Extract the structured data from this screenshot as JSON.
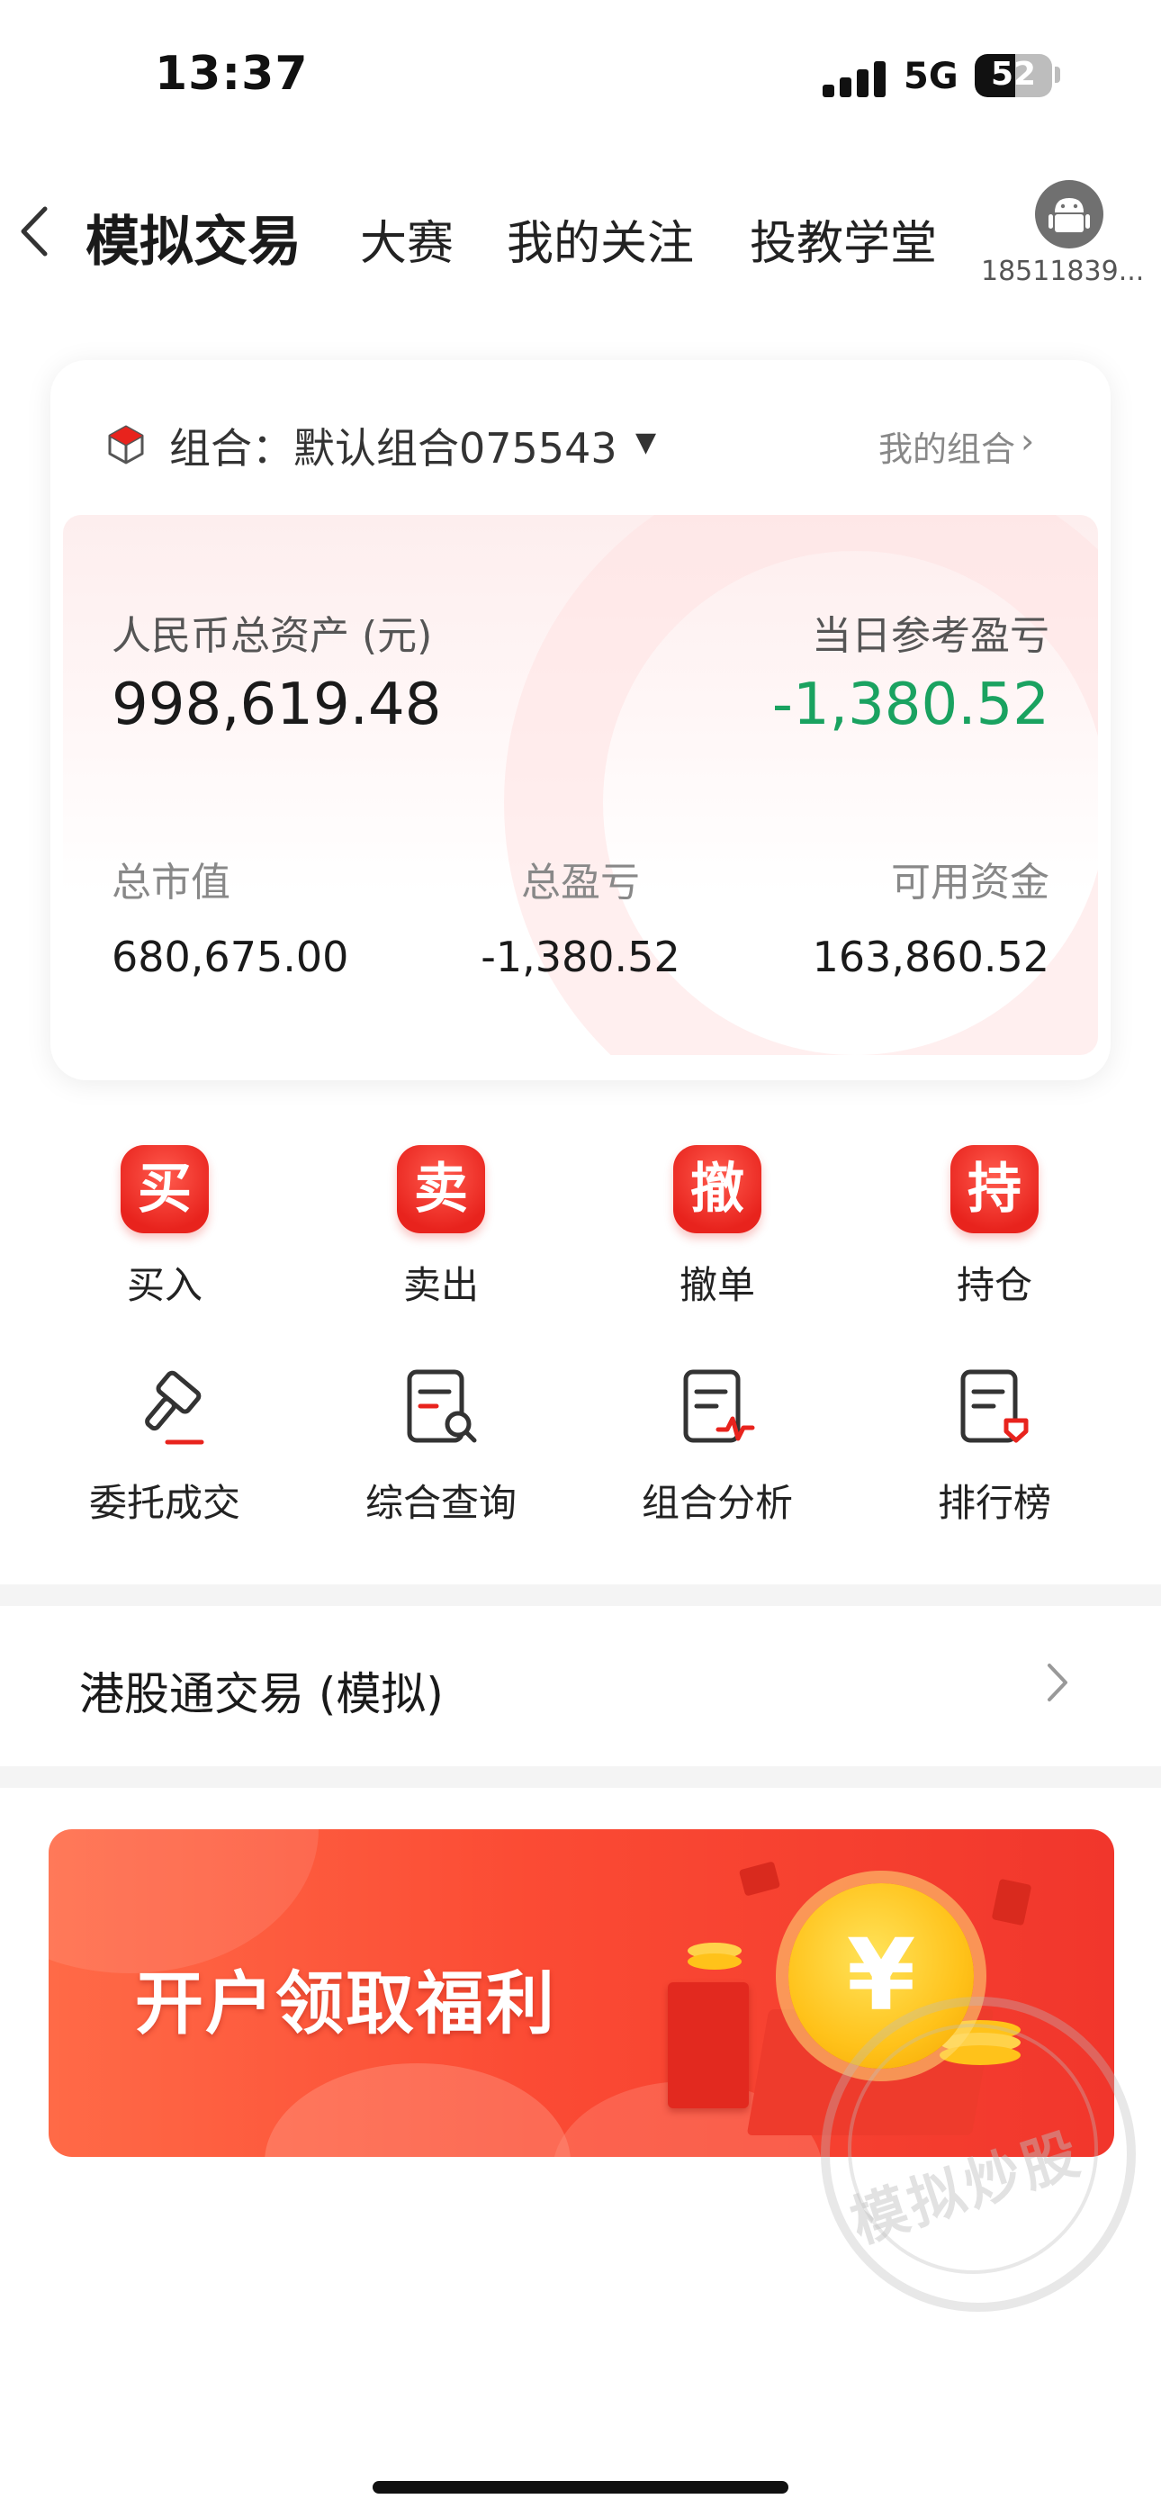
{
  "status_bar": {
    "time": "13:37",
    "network": "5G",
    "battery": "52",
    "battery_level": 0.52
  },
  "nav": {
    "active_tab": "模拟交易",
    "tabs": [
      "大赛",
      "我的关注",
      "投教学堂"
    ],
    "user_id": "18511839..."
  },
  "portfolio": {
    "label": "组合：默认组合075543",
    "my_portfolio_link": "我的组合",
    "total_assets_label": "人民币总资产 (元)",
    "total_assets_value": "998,619.48",
    "daily_pnl_label": "当日参考盈亏",
    "daily_pnl_value": "-1,380.52",
    "market_value_label": "总市值",
    "market_value": "680,675.00",
    "total_pnl_label": "总盈亏",
    "total_pnl_value": "-1,380.52",
    "available_cash_label": "可用资金",
    "available_cash": "163,860.52"
  },
  "quick_actions": [
    {
      "icon_char": "买",
      "label": "买入",
      "icon": "buy-icon"
    },
    {
      "icon_char": "卖",
      "label": "卖出",
      "icon": "sell-icon"
    },
    {
      "icon_char": "撤",
      "label": "撤单",
      "icon": "cancel-order-icon"
    },
    {
      "icon_char": "持",
      "label": "持仓",
      "icon": "holdings-icon"
    }
  ],
  "tools": [
    {
      "label": "委托成交",
      "icon": "gavel-icon"
    },
    {
      "label": "综合查询",
      "icon": "document-search-icon"
    },
    {
      "label": "组合分析",
      "icon": "document-pulse-icon"
    },
    {
      "label": "排行榜",
      "icon": "document-badge-icon"
    }
  ],
  "hk_connect": {
    "label": "港股通交易 (模拟)"
  },
  "banner": {
    "title": "开户领取福利",
    "coin_symbol": "¥",
    "stamp_text": "模拟炒股"
  },
  "colors": {
    "accent_red": "#e8231d",
    "gain_green": "#1aa260"
  }
}
